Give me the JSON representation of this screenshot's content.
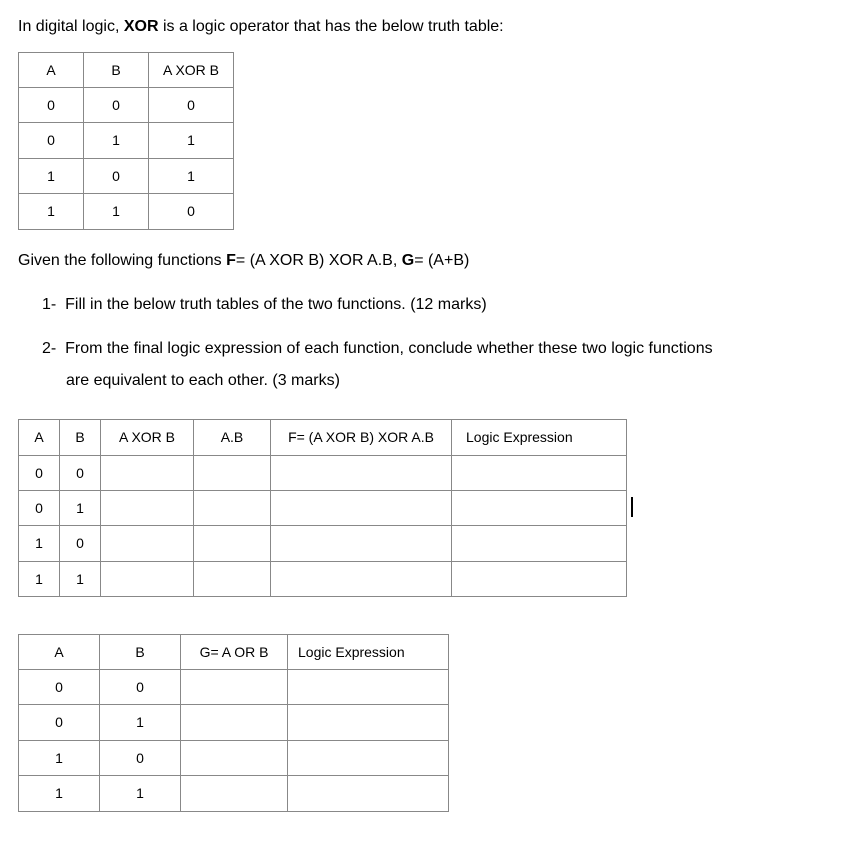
{
  "intro": {
    "prefix": "In digital logic, ",
    "bold": "XOR",
    "suffix": " is a logic operator that has the below truth table:"
  },
  "xor_table": {
    "headers": [
      "A",
      "B",
      "A XOR B"
    ],
    "rows": [
      [
        "0",
        "0",
        "0"
      ],
      [
        "0",
        "1",
        "1"
      ],
      [
        "1",
        "0",
        "1"
      ],
      [
        "1",
        "1",
        "0"
      ]
    ]
  },
  "given": {
    "prefix": "Given the following functions ",
    "f_label": "F",
    "f_eq": "= (A XOR B) XOR A.B, ",
    "g_label": "G",
    "g_eq": "= (A+B)"
  },
  "questions": {
    "q1_num": "1-",
    "q1": "Fill in the below truth tables of the two functions. (12 marks)",
    "q2_num": "2-",
    "q2a": "From the final logic expression of each function, conclude whether these two logic functions",
    "q2b": "are equivalent to each other. (3 marks)"
  },
  "f_table": {
    "headers": [
      "A",
      "B",
      "A XOR B",
      "A.B",
      "F= (A XOR B) XOR A.B",
      "Logic Expression"
    ],
    "rows": [
      [
        "0",
        "0",
        "",
        "",
        "",
        ""
      ],
      [
        "0",
        "1",
        "",
        "",
        "",
        ""
      ],
      [
        "1",
        "0",
        "",
        "",
        "",
        ""
      ],
      [
        "1",
        "1",
        "",
        "",
        "",
        ""
      ]
    ]
  },
  "g_table": {
    "headers": [
      "A",
      "B",
      "G= A OR B",
      "Logic Expression"
    ],
    "rows": [
      [
        "0",
        "0",
        "",
        ""
      ],
      [
        "0",
        "1",
        "",
        ""
      ],
      [
        "1",
        "0",
        "",
        ""
      ],
      [
        "1",
        "1",
        "",
        ""
      ]
    ]
  }
}
